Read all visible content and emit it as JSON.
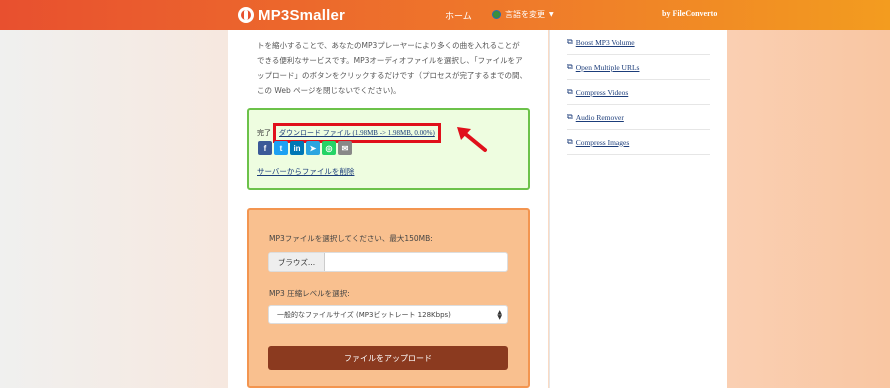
{
  "header": {
    "logo_text": "MP3Smaller",
    "nav_home": "ホーム",
    "nav_language": "言語を変更",
    "byline": "by FileConverto"
  },
  "intro": {
    "text": "トを縮小することで、あなたのMP3プレーヤーにより多くの曲を入れることができる便利なサービスです。MP3オーディオファイルを選択し、「ファイルをアップロード」のボタンをクリックするだけです（プロセスが完了するまでの間、この Web ページを閉じないでください)。"
  },
  "result": {
    "done_label": "完了",
    "download_link": "ダウンロード ファイル (1.98MB -> 1.98MB, 0.00%)",
    "share_buttons": [
      "f",
      "t",
      "in",
      "➤",
      "◎",
      "✉"
    ],
    "share_colors": [
      "#3b5998",
      "#1da1f2",
      "#0077b5",
      "#2ca5e0",
      "#25d366",
      "#888888"
    ],
    "delete_link": "サーバーからファイルを削除"
  },
  "upload": {
    "file_label": "MP3ファイルを選択してください、最大150MB:",
    "browse_label": "ブラウズ...",
    "level_label": "MP3 圧縮レベルを選択:",
    "level_selected": "一般的なファイルサイズ (MP3ビットレート 128Kbps)",
    "upload_button": "ファイルをアップロード"
  },
  "sidebar": {
    "items": [
      {
        "label": "Boost MP3 Volume"
      },
      {
        "label": "Open Multiple URLs"
      },
      {
        "label": "Compress Videos"
      },
      {
        "label": "Audio Remover"
      },
      {
        "label": "Compress Images"
      }
    ]
  },
  "colors": {
    "header_start": "#e8502f",
    "header_end": "#f39c1f",
    "success_border": "#6cc24a",
    "highlight_red": "#e0101b",
    "upload_button": "#8b3a1f"
  }
}
